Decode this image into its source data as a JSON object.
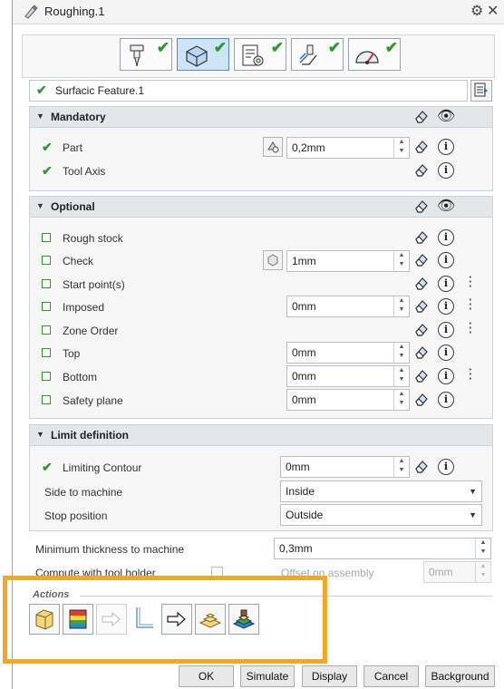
{
  "window": {
    "title": "Roughing.1"
  },
  "feature": {
    "name": "Surfacic Feature.1"
  },
  "mandatory": {
    "title": "Mandatory",
    "part": {
      "label": "Part",
      "value": "0,2mm"
    },
    "tool_axis": {
      "label": "Tool Axis"
    }
  },
  "optional": {
    "title": "Optional",
    "rough_stock": "Rough stock",
    "check": {
      "label": "Check",
      "value": "1mm"
    },
    "start_points": "Start point(s)",
    "imposed": {
      "label": "Imposed",
      "value": "0mm"
    },
    "zone_order": "Zone Order",
    "top": {
      "label": "Top",
      "value": "0mm"
    },
    "bottom": {
      "label": "Bottom",
      "value": "0mm"
    },
    "safety_plane": {
      "label": "Safety plane",
      "value": "0mm"
    }
  },
  "limit": {
    "title": "Limit definition",
    "limiting_contour": {
      "label": "Limiting Contour",
      "value": "0mm"
    },
    "side_to_machine": {
      "label": "Side to machine",
      "value": "Inside"
    },
    "stop_position": {
      "label": "Stop position",
      "value": "Outside"
    }
  },
  "min_thickness": {
    "label": "Minimum thickness to machine",
    "value": "0,3mm"
  },
  "compute_tool_holder": {
    "label": "Compute with tool holder"
  },
  "offset_assembly": {
    "label": "Offset on assembly",
    "value": "0mm"
  },
  "actions": {
    "title": "Actions"
  },
  "buttons": {
    "ok": "OK",
    "simulate": "Simulate",
    "display": "Display",
    "cancel": "Cancel",
    "background": "Background"
  },
  "colors": {
    "check_green": "#2e9a2e",
    "highlight_orange": "#f5a623",
    "selected_tab": "#cfe5f7"
  },
  "icons": [
    "tool-tab-icon",
    "geometry-tab-icon",
    "strategy-tab-icon",
    "macro-tab-icon",
    "feedrate-tab-icon"
  ]
}
